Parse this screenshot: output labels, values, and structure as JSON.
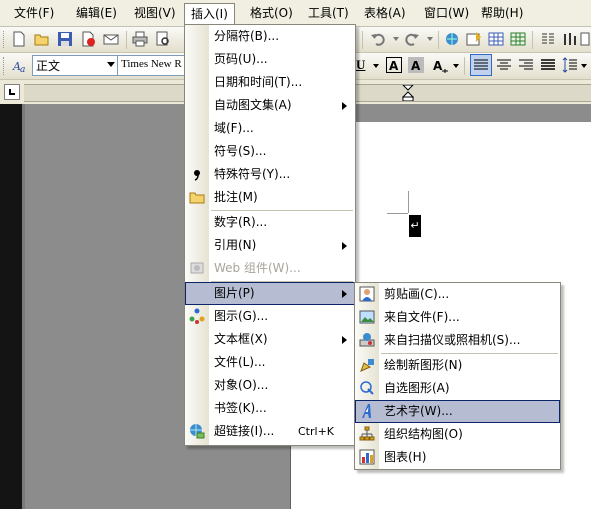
{
  "menubar": {
    "items": [
      {
        "label": "文件(F)"
      },
      {
        "label": "编辑(E)"
      },
      {
        "label": "视图(V)"
      },
      {
        "label": "插入(I)"
      },
      {
        "label": "格式(O)"
      },
      {
        "label": "工具(T)"
      },
      {
        "label": "表格(A)"
      },
      {
        "label": "窗口(W)"
      },
      {
        "label": "帮助(H)"
      }
    ],
    "active_index": 3
  },
  "format_toolbar": {
    "style_value": "正文",
    "font_value": "Times New R"
  },
  "insert_menu": {
    "items": [
      {
        "label": "分隔符(B)...",
        "icon": "",
        "submenu": false
      },
      {
        "label": "页码(U)...",
        "icon": "",
        "submenu": false
      },
      {
        "label": "日期和时间(T)...",
        "icon": "",
        "submenu": false
      },
      {
        "label": "自动图文集(A)",
        "icon": "",
        "submenu": true
      },
      {
        "label": "域(F)...",
        "icon": "",
        "submenu": false
      },
      {
        "label": "符号(S)...",
        "icon": "",
        "submenu": false
      },
      {
        "label": "特殊符号(Y)...",
        "icon": "special-symbol-icon",
        "submenu": false
      },
      {
        "label": "批注(M)",
        "icon": "comment-icon",
        "submenu": false
      },
      {
        "label": "数字(R)...",
        "icon": "",
        "submenu": false
      },
      {
        "label": "引用(N)",
        "icon": "",
        "submenu": true
      },
      {
        "label": "Web 组件(W)...",
        "icon": "web-component-icon",
        "submenu": false,
        "disabled": true
      },
      {
        "label": "图片(P)",
        "icon": "",
        "submenu": true,
        "highlighted": true
      },
      {
        "label": "图示(G)...",
        "icon": "diagram-icon",
        "submenu": false
      },
      {
        "label": "文本框(X)",
        "icon": "",
        "submenu": true
      },
      {
        "label": "文件(L)...",
        "icon": "",
        "submenu": false
      },
      {
        "label": "对象(O)...",
        "icon": "",
        "submenu": false
      },
      {
        "label": "书签(K)...",
        "icon": "",
        "submenu": false
      },
      {
        "label": "超链接(I)...",
        "icon": "hyperlink-icon",
        "submenu": false,
        "shortcut": "Ctrl+K"
      }
    ]
  },
  "picture_submenu": {
    "items": [
      {
        "label": "剪贴画(C)...",
        "icon": "clipart-icon"
      },
      {
        "label": "来自文件(F)...",
        "icon": "picture-from-file-icon"
      },
      {
        "label": "来自扫描仪或照相机(S)...",
        "icon": "scanner-camera-icon"
      },
      {
        "label": "绘制新图形(N)",
        "icon": "new-drawing-icon"
      },
      {
        "label": "自选图形(A)",
        "icon": "autoshapes-icon"
      },
      {
        "label": "艺术字(W)...",
        "icon": "wordart-icon",
        "highlighted": true
      },
      {
        "label": "组织结构图(O)",
        "icon": "org-chart-icon"
      },
      {
        "label": "图表(H)",
        "icon": "chart-icon"
      }
    ]
  },
  "colors": {
    "menu_highlight": "#b6bdd2",
    "menu_highlight_border": "#0a246a",
    "menubar_bg": "#f1efe2"
  }
}
